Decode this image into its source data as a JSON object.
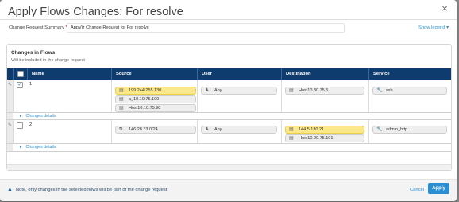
{
  "dialog": {
    "title": "Apply Flows Changes: For resolve",
    "close_glyph": "×"
  },
  "form": {
    "summary_label": "Change Request Summary",
    "required_mark": "*",
    "summary_value": "AppViz Change Request for For resolve",
    "show_legend": "Show legend ▾"
  },
  "panel": {
    "title": "Changes in Flows",
    "subtitle": "Will be included in the change request"
  },
  "table": {
    "columns": [
      "Name",
      "Source",
      "User",
      "Destination",
      "Service"
    ],
    "rows": [
      {
        "name": "1",
        "checked": true,
        "check_glyph": "✓",
        "sources": [
          {
            "label": "199.244.255.130",
            "highlight": true,
            "icon": "server-icon"
          },
          {
            "label": "a_10.10.75.100",
            "highlight": false,
            "icon": "server-icon"
          },
          {
            "label": "Host10.10.75.90",
            "highlight": false,
            "icon": "server-icon"
          }
        ],
        "user": {
          "label": "Any",
          "icon": "user-icon"
        },
        "destinations": [
          {
            "label": "Host10.30.75.5",
            "highlight": false,
            "icon": "server-icon"
          }
        ],
        "service": {
          "label": "ssh",
          "icon": "wrench-icon"
        },
        "details_label": "Changes details"
      },
      {
        "name": "2",
        "checked": false,
        "check_glyph": "",
        "sources": [
          {
            "label": "146.28.33.0/24",
            "highlight": false,
            "icon": "network-icon"
          }
        ],
        "user": {
          "label": "Any",
          "icon": "user-icon"
        },
        "destinations": [
          {
            "label": "144.5.130.21",
            "highlight": true,
            "icon": "server-icon"
          },
          {
            "label": "Host10.20.75.101",
            "highlight": false,
            "icon": "server-icon"
          }
        ],
        "service": {
          "label": "admin_http",
          "icon": "wrench-icon"
        },
        "details_label": "Changes details"
      }
    ]
  },
  "footer": {
    "note": "Note, only changes in the selected flows will be part of the change request",
    "cancel_label": "Cancel",
    "apply_label": "Apply"
  },
  "colors": {
    "header_bg": "#0e3c6e",
    "highlight": "#fbe88a",
    "link": "#2a8ed2",
    "apply_bg": "#2a8ed2"
  }
}
